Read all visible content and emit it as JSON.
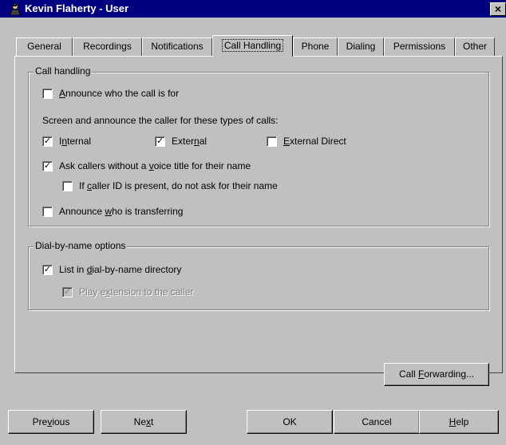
{
  "window": {
    "title": "Kevin Flaherty - User",
    "close_glyph": "×"
  },
  "tabs": [
    {
      "label": "General",
      "active": false
    },
    {
      "label": "Recordings",
      "active": false
    },
    {
      "label": "Notifications",
      "active": false
    },
    {
      "label": "Call Handling",
      "active": true
    },
    {
      "label": "Phone",
      "active": false
    },
    {
      "label": "Dialing",
      "active": false
    },
    {
      "label": "Permissions",
      "active": false
    },
    {
      "label": "Other",
      "active": false
    }
  ],
  "call_handling": {
    "group_label": "Call handling",
    "announce_who_for": {
      "pre": "",
      "ul": "A",
      "post": "nnounce who the call is for",
      "checked": false
    },
    "screen_text": "Screen and announce the caller for these types of calls:",
    "internal": {
      "pre": "I",
      "ul": "n",
      "post": "ternal",
      "checked": true
    },
    "external": {
      "pre": "Exter",
      "ul": "n",
      "post": "al",
      "checked": true
    },
    "external_direct": {
      "pre": "",
      "ul": "E",
      "post": "xternal Direct",
      "checked": false
    },
    "ask_callers": {
      "pre": "Ask callers without a ",
      "ul": "v",
      "post": "oice title for their name",
      "checked": true
    },
    "caller_id": {
      "pre": "If ",
      "ul": "c",
      "post": "aller ID is present, do not ask for their name",
      "checked": false
    },
    "announce_transferring": {
      "pre": "Announce ",
      "ul": "w",
      "post": "ho is transferring",
      "checked": false
    }
  },
  "dial_by_name": {
    "group_label": "Dial-by-name options",
    "list_in_directory": {
      "pre": "List in ",
      "ul": "d",
      "post": "ial-by-name directory",
      "checked": true
    },
    "play_extension": {
      "pre": "Play e",
      "ul": "x",
      "post": "tension to the caller",
      "checked": true,
      "disabled": true
    }
  },
  "call_forwarding": {
    "pre": "Call ",
    "ul": "F",
    "post": "orwarding..."
  },
  "footer": {
    "previous": {
      "pre": "Pre",
      "ul": "v",
      "post": "ious"
    },
    "next": {
      "pre": "Ne",
      "ul": "x",
      "post": "t"
    },
    "ok": {
      "pre": "OK",
      "ul": "",
      "post": ""
    },
    "cancel": {
      "pre": "Cancel",
      "ul": "",
      "post": ""
    },
    "help": {
      "pre": "",
      "ul": "H",
      "post": "elp"
    }
  },
  "check_glyph": "✓",
  "colors": {
    "titlebar": "#000080",
    "face": "#c0c0c0"
  }
}
